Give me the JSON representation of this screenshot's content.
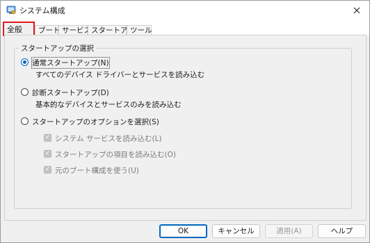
{
  "window": {
    "title": "システム構成"
  },
  "tabs": [
    {
      "label": "全般",
      "active": true
    },
    {
      "label": "ブート",
      "active": false
    },
    {
      "label": "サービス",
      "active": false
    },
    {
      "label": "スタートアップ",
      "active": false
    },
    {
      "label": "ツール",
      "active": false
    }
  ],
  "general": {
    "group_title": "スタートアップの選択",
    "normal": {
      "label": "通常スタートアップ(N)",
      "desc": "すべてのデバイス ドライバーとサービスを読み込む",
      "checked": true
    },
    "diagnostic": {
      "label": "診断スタートアップ(D)",
      "desc": "基本的なデバイスとサービスのみを読み込む",
      "checked": false
    },
    "selective": {
      "label": "スタートアップのオプションを選択(S)",
      "checked": false,
      "options": [
        {
          "label": "システム サービスを読み込む(L)",
          "checked": true,
          "enabled": false
        },
        {
          "label": "スタートアップの項目を読み込む(O)",
          "checked": true,
          "enabled": false
        },
        {
          "label": "元のブート構成を使う(U)",
          "checked": true,
          "enabled": false
        }
      ]
    }
  },
  "buttons": {
    "ok": "OK",
    "cancel": "キャンセル",
    "apply": "適用(A)",
    "help": "ヘルプ"
  },
  "colors": {
    "accent": "#0067c0",
    "highlight_box": "#e0161d"
  },
  "icons": {
    "app": "msconfig-icon",
    "close": "close-icon"
  }
}
